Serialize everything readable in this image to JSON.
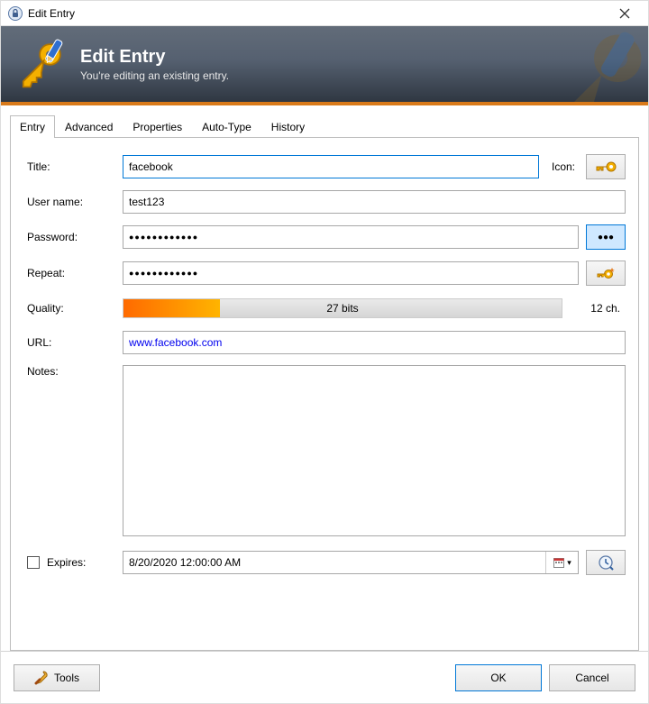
{
  "window": {
    "title": "Edit Entry"
  },
  "banner": {
    "title": "Edit Entry",
    "subtitle": "You're editing an existing entry."
  },
  "tabs": [
    "Entry",
    "Advanced",
    "Properties",
    "Auto-Type",
    "History"
  ],
  "labels": {
    "title": "Title:",
    "icon": "Icon:",
    "username": "User name:",
    "password": "Password:",
    "repeat": "Repeat:",
    "quality": "Quality:",
    "url": "URL:",
    "notes": "Notes:",
    "expires": "Expires:"
  },
  "fields": {
    "title": "facebook",
    "username": "test123",
    "password_masked": "●●●●●●●●●●●●",
    "repeat_masked": "●●●●●●●●●●●●",
    "quality_bits": "27 bits",
    "quality_chars": "12 ch.",
    "url": "www.facebook.com",
    "notes": "",
    "expires_value": "8/20/2020 12:00:00 AM"
  },
  "buttons": {
    "tools": "Tools",
    "ok": "OK",
    "cancel": "Cancel"
  },
  "icons": {
    "show_password": "●●●",
    "dropdown": "▾"
  }
}
